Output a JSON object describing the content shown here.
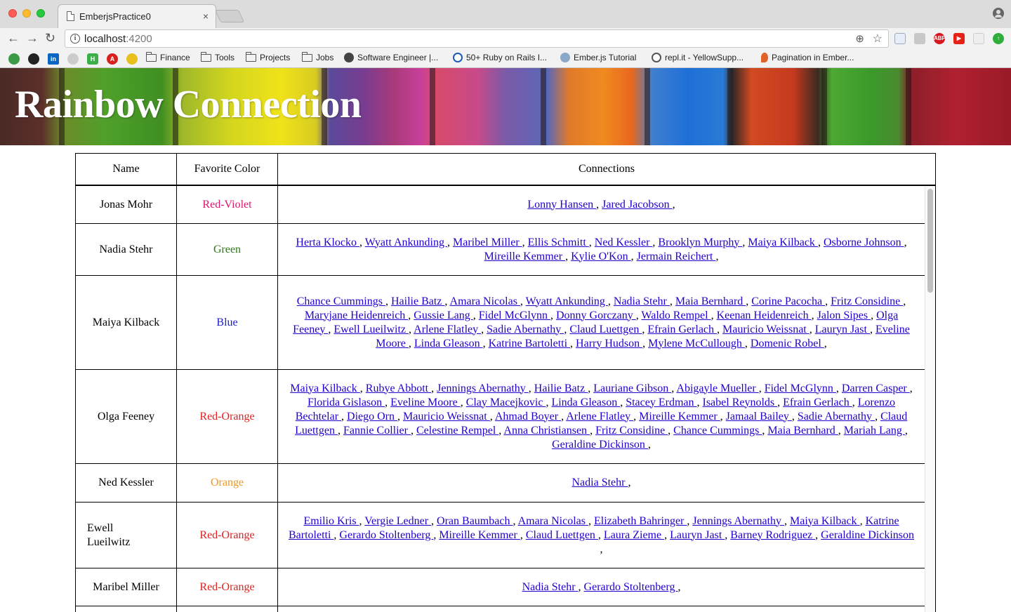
{
  "browser": {
    "tab_title": "EmberjsPractice0",
    "tab_close": "×",
    "url_host": "localhost",
    "url_port": ":4200",
    "back": "←",
    "forward": "→",
    "reload": "↻",
    "bookmarks": [
      {
        "label": "Finance",
        "type": "folder"
      },
      {
        "label": "Tools",
        "type": "folder"
      },
      {
        "label": "Projects",
        "type": "folder"
      },
      {
        "label": "Jobs",
        "type": "folder"
      },
      {
        "label": "Software Engineer |...",
        "type": "site"
      },
      {
        "label": "50+ Ruby on Rails I...",
        "type": "site"
      },
      {
        "label": "Ember.js Tutorial",
        "type": "site"
      },
      {
        "label": "repl.it - YellowSupp...",
        "type": "site"
      },
      {
        "label": "Pagination in Ember...",
        "type": "site"
      }
    ]
  },
  "page": {
    "banner_title": "Rainbow Connection",
    "columns": [
      "Name",
      "Favorite Color",
      "Connections"
    ],
    "rows": [
      {
        "name": "Jonas Mohr",
        "color": "Red-Violet",
        "color_hex": "#d6176f",
        "connections": [
          "Lonny Hansen",
          "Jared Jacobson"
        ]
      },
      {
        "name": "Nadia Stehr",
        "color": "Green",
        "color_hex": "#2a7a16",
        "connections": [
          "Herta Klocko",
          "Wyatt Ankunding",
          "Maribel Miller",
          "Ellis Schmitt",
          "Ned Kessler",
          "Brooklyn Murphy",
          "Maiya Kilback",
          "Osborne Johnson",
          "Mireille Kemmer",
          "Kylie O'Kon",
          "Jermain Reichert"
        ]
      },
      {
        "name": "Maiya Kilback",
        "color": "Blue",
        "color_hex": "#1a1ad6",
        "connections": [
          "Chance Cummings",
          "Hailie Batz",
          "Amara Nicolas",
          "Wyatt Ankunding",
          "Nadia Stehr",
          "Maia Bernhard",
          "Corine Pacocha",
          "Fritz Considine",
          "Maryjane Heidenreich",
          "Gussie Lang",
          "Fidel McGlynn",
          "Donny Gorczany",
          "Waldo Rempel",
          "Keenan Heidenreich",
          "Jalon Sipes",
          "Olga Feeney",
          "Ewell Lueilwitz",
          "Arlene Flatley",
          "Sadie Abernathy",
          "Claud Luettgen",
          "Efrain Gerlach",
          "Mauricio Weissnat",
          "Lauryn Jast",
          "Eveline Moore",
          "Linda Gleason",
          "Katrine Bartoletti",
          "Harry Hudson",
          "Mylene McCullough",
          "Domenic Robel"
        ]
      },
      {
        "name": "Olga Feeney",
        "color": "Red-Orange",
        "color_hex": "#e0211d",
        "connections": [
          "Maiya Kilback",
          "Rubye Abbott",
          "Jennings Abernathy",
          "Hailie Batz",
          "Lauriane Gibson",
          "Abigayle Mueller",
          "Fidel McGlynn",
          "Darren Casper",
          "Florida Gislason",
          "Eveline Moore",
          "Clay Macejkovic",
          "Linda Gleason",
          "Stacey Erdman",
          "Isabel Reynolds",
          "Efrain Gerlach",
          "Lorenzo Bechtelar",
          "Diego Orn",
          "Mauricio Weissnat",
          "Ahmad Boyer",
          "Arlene Flatley",
          "Mireille Kemmer",
          "Jamaal Bailey",
          "Sadie Abernathy",
          "Claud Luettgen",
          "Fannie Collier",
          "Celestine Rempel",
          "Anna Christiansen",
          "Fritz Considine",
          "Chance Cummings",
          "Maia Bernhard",
          "Mariah Lang",
          "Geraldine Dickinson"
        ]
      },
      {
        "name": "Ned Kessler",
        "color": "Orange",
        "color_hex": "#f2951f",
        "connections": [
          "Nadia Stehr"
        ]
      },
      {
        "name": "Ewell Lueilwitz",
        "color": "Red-Orange",
        "color_hex": "#e0211d",
        "connections": [
          "Emilio Kris",
          "Vergie Ledner",
          "Oran Baumbach",
          "Amara Nicolas",
          "Elizabeth Bahringer",
          "Jennings Abernathy",
          "Maiya Kilback",
          "Katrine Bartoletti",
          "Gerardo Stoltenberg",
          "Mireille Kemmer",
          "Claud Luettgen",
          "Laura Zieme",
          "Lauryn Jast",
          "Barney Rodriguez",
          "Geraldine Dickinson"
        ]
      },
      {
        "name": "Maribel Miller",
        "color": "Red-Orange",
        "color_hex": "#e0211d",
        "connections": [
          "Nadia Stehr",
          "Gerardo Stoltenberg"
        ]
      }
    ]
  }
}
